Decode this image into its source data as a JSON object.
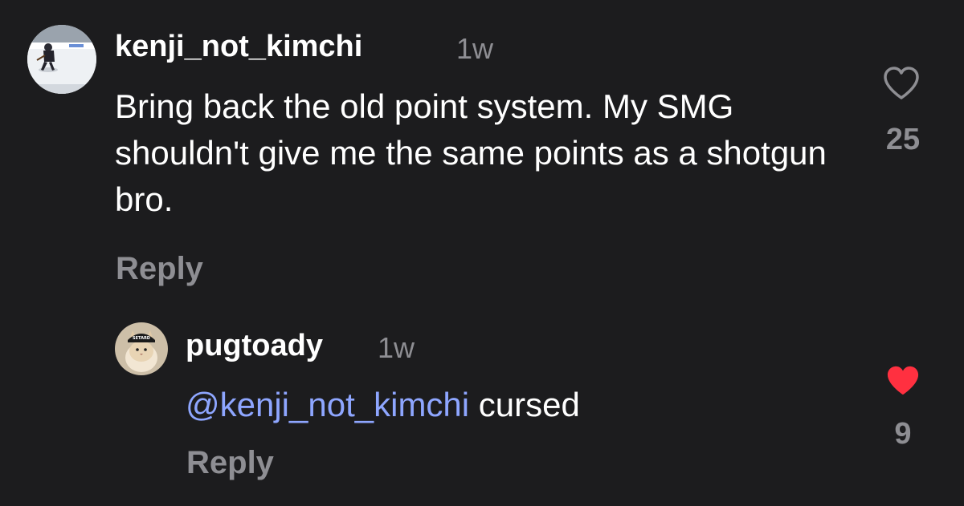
{
  "comments": [
    {
      "username": "kenji_not_kimchi",
      "time": "1w",
      "text": "Bring back the old point system. My SMG shouldn't give me the same points as a shotgun bro.",
      "reply_label": "Reply",
      "likes": "25",
      "liked": false,
      "avatar_icon": "hockey-player-avatar",
      "like_icon": "heart-outline-icon"
    },
    {
      "username": "pugtoady",
      "time": "1w",
      "mention": "@kenji_not_kimchi",
      "text": "cursed",
      "reply_label": "Reply",
      "likes": "9",
      "liked": true,
      "avatar_icon": "cat-with-cap-avatar",
      "avatar_cap_text": "SETARD",
      "like_icon": "heart-filled-icon"
    }
  ],
  "colors": {
    "background": "#1c1c1e",
    "text": "#ffffff",
    "muted": "#8e8e93",
    "mention": "#8ea6ff",
    "liked_heart": "#ff3040"
  }
}
